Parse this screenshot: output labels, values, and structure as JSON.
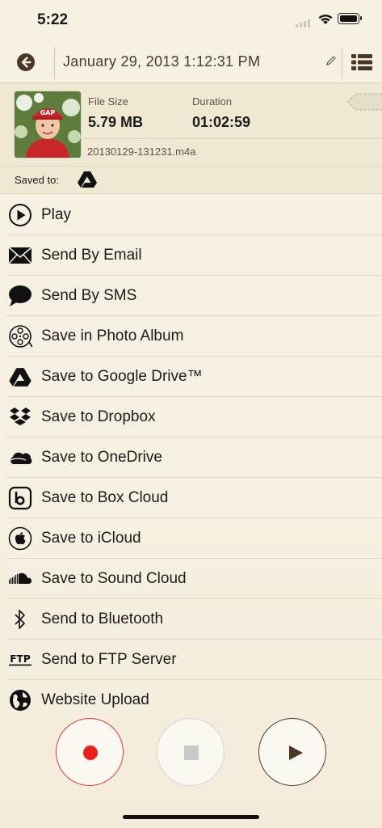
{
  "status_bar": {
    "time": "5:22"
  },
  "nav": {
    "title": "January 29, 2013 1:12:31 PM"
  },
  "info": {
    "file_size_label": "File Size",
    "file_size_value": "5.79 MB",
    "duration_label": "Duration",
    "duration_value": "01:02:59",
    "filename": "20130129-131231.m4a",
    "thumbnail_cap_text": "GAP"
  },
  "saved_to": {
    "label": "Saved to:",
    "icon": "google-drive-icon"
  },
  "menu": {
    "items": [
      {
        "label": "Play",
        "icon": "play-circle-icon"
      },
      {
        "label": "Send By Email",
        "icon": "envelope-icon"
      },
      {
        "label": "Send By SMS",
        "icon": "speech-bubble-icon"
      },
      {
        "label": "Save in Photo Album",
        "icon": "film-reel-icon"
      },
      {
        "label": "Save to Google Drive™",
        "icon": "google-drive-icon"
      },
      {
        "label": "Save to Dropbox",
        "icon": "dropbox-icon"
      },
      {
        "label": "Save to OneDrive",
        "icon": "onedrive-icon"
      },
      {
        "label": "Save to Box Cloud",
        "icon": "box-icon"
      },
      {
        "label": "Save to iCloud",
        "icon": "apple-icon"
      },
      {
        "label": "Save to Sound Cloud",
        "icon": "soundcloud-icon"
      },
      {
        "label": "Send to Bluetooth",
        "icon": "bluetooth-icon"
      },
      {
        "label": "Send to FTP Server",
        "icon": "ftp-icon"
      },
      {
        "label": "Website Upload",
        "icon": "globe-icon"
      }
    ]
  },
  "colors": {
    "background": "#f7f1e3",
    "header_panel": "#efe8d3",
    "brown": "#4a3727",
    "record_red": "#e8201c"
  }
}
